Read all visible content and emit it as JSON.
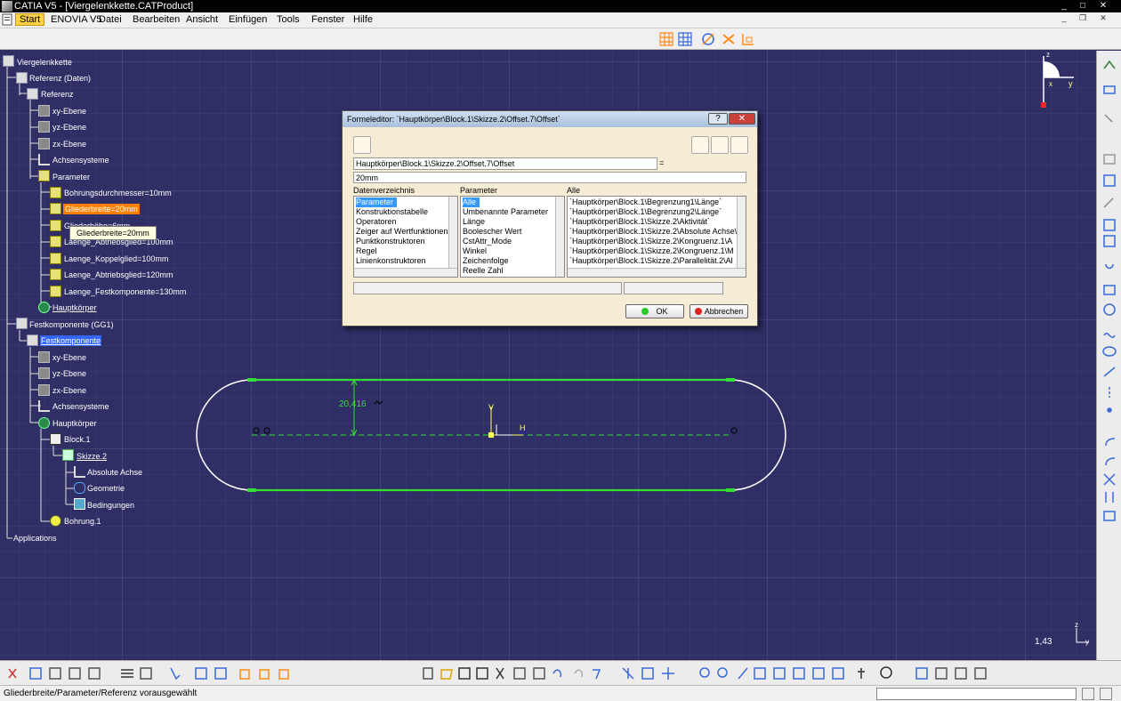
{
  "window": {
    "title": "CATIA V5 - [Viergelenkkette.CATProduct]"
  },
  "menu": {
    "items": [
      "Start",
      "ENOVIA V5",
      "Datei",
      "Bearbeiten",
      "Ansicht",
      "Einfügen",
      "Tools",
      "Fenster",
      "Hilfe"
    ]
  },
  "tree": {
    "nodes": [
      "Viergelenkkette",
      "Referenz (Daten)",
      "Referenz",
      "xy-Ebene",
      "yz-Ebene",
      "zx-Ebene",
      "Achsensysteme",
      "Parameter",
      "Bohrungsdurchmesser=10mm",
      "Gliederbreite=20mm",
      "Gliederhöhe=6mm",
      "Laenge_Abtriebsglied=100mm",
      "Laenge_Koppelglied=100mm",
      "Laenge_Abtriebsglied=120mm",
      "Laenge_Festkomponente=130mm",
      "Hauptkörper",
      "Festkomponente (GG1)",
      "Festkomponente",
      "xy-Ebene",
      "yz-Ebene",
      "zx-Ebene",
      "Achsensysteme",
      "Hauptkörper",
      "Block.1",
      "Skizze.2",
      "Absolute Achse",
      "Geometrie",
      "Bedingungen",
      "Bohrung.1",
      "Applications"
    ],
    "tooltip": "Gliederbreite=20mm"
  },
  "sketch": {
    "dimension": "20,416",
    "h_label": "H",
    "v_label": "V"
  },
  "compass": {
    "x_label": "x",
    "y_label": "y",
    "z_label": "z"
  },
  "zoom": "1,43",
  "axis_corner": {
    "z": "z",
    "y": "y"
  },
  "dialog": {
    "title": "Formeleditor: `Hauptkörper\\Block.1\\Skizze.2\\Offset.7\\Offset`",
    "help_btn": "?",
    "close_btn": "✕",
    "param_path": "Hauptkörper\\Block.1\\Skizze.2\\Offset.7\\Offset",
    "equals": "=",
    "formula": "20mm",
    "col1_header": "Datenverzeichnis",
    "col2_header": "Parameter",
    "col3_header": "Alle",
    "col1_items": [
      "Parameter",
      "Konstruktionstabelle",
      "Operatoren",
      "Zeiger auf Wertfunktionen",
      "Punktkonstruktoren",
      "Regel",
      "Linienkonstruktoren"
    ],
    "col2_items": [
      "Alle",
      "Umbenannte Parameter",
      "Länge",
      "Boolescher Wert",
      "CstAttr_Mode",
      "Winkel",
      "Zeichenfolge",
      "Reelle Zahl"
    ],
    "col3_items": [
      "`Hauptkörper\\Block.1\\Begrenzung1\\Länge`",
      "`Hauptkörper\\Block.1\\Begrenzung2\\Länge`",
      "`Hauptkörper\\Block.1\\Skizze.2\\Aktivität`",
      "`Hauptkörper\\Block.1\\Skizze.2\\Absolute Achse\\",
      "`Hauptkörper\\Block.1\\Skizze.2\\Kongruenz.1\\A",
      "`Hauptkörper\\Block.1\\Skizze.2\\Kongruenz.1\\M",
      "`Hauptkörper\\Block.1\\Skizze.2\\Parallelität.2\\Al"
    ],
    "ok": "OK",
    "cancel": "Abbrechen"
  },
  "status": {
    "text": "Gliederbreite/Parameter/Referenz vorausgewählt"
  },
  "colors": {
    "canvas": "#2f2f66",
    "sketch_line": "#33dd33",
    "selection": "#ff8000"
  }
}
